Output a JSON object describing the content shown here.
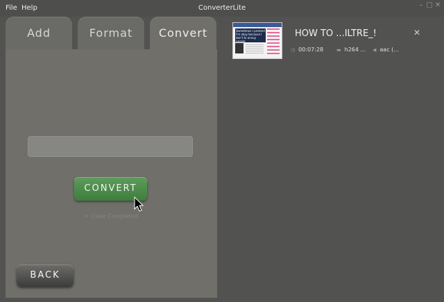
{
  "window": {
    "title": "ConverterLite",
    "menu": [
      "File",
      "Help"
    ],
    "controls": [
      "minimize",
      "maximize",
      "close"
    ]
  },
  "tabs": [
    {
      "label": "Add",
      "active": false
    },
    {
      "label": "Format",
      "active": false
    },
    {
      "label": "Convert",
      "active": true
    }
  ],
  "convert_panel": {
    "output_value": "",
    "convert_label": "CONVERT",
    "clear_completed_label": "Clear Completed",
    "clear_completed_icon": "x-icon",
    "back_label": "BACK"
  },
  "file": {
    "title": "HOW TO ...ILTRE_!",
    "duration": "00:07:28",
    "video_codec": "h264 ...",
    "audio_codec": "aac (...",
    "thumbnail_text": "Sometimes I pretend I'm okay because I don't to annoy people"
  },
  "colors": {
    "background": "#525250",
    "panel": "#706f6a",
    "convert_button": "#4e8c4c",
    "back_button": "#4e4e4c"
  }
}
